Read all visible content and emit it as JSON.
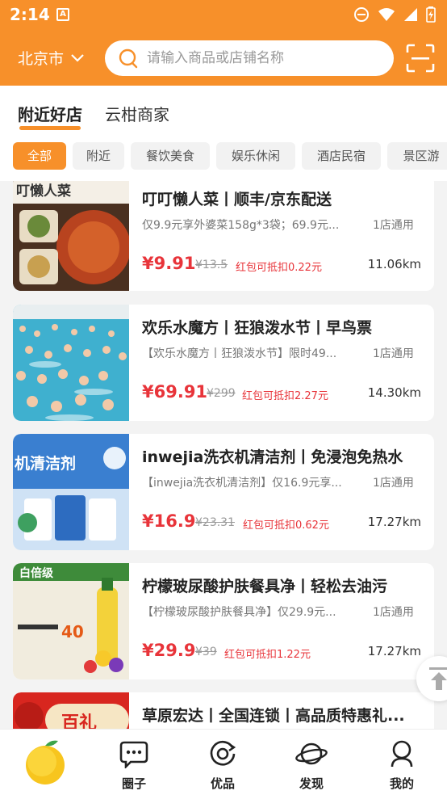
{
  "status_bar": {
    "time": "2:14",
    "icons": [
      "a-notification-icon",
      "dnd-icon",
      "wifi-icon",
      "signal-icon",
      "battery-icon"
    ]
  },
  "header": {
    "city": "北京市",
    "search_placeholder": "请输入商品或店铺名称",
    "accent_color": "#f7902a"
  },
  "tabs": [
    {
      "label": "附近好店",
      "active": true
    },
    {
      "label": "云柑商家",
      "active": false
    }
  ],
  "filters": [
    {
      "label": "全部",
      "active": true
    },
    {
      "label": "附近",
      "active": false
    },
    {
      "label": "餐饮美食",
      "active": false
    },
    {
      "label": "娱乐休闲",
      "active": false
    },
    {
      "label": "酒店民宿",
      "active": false
    },
    {
      "label": "景区游",
      "active": false
    }
  ],
  "items": [
    {
      "title": "叮叮懒人菜丨顺丰/京东配送",
      "desc": "仅9.9元享外婆菜158g*3袋；69.9元...",
      "scope": "1店通用",
      "price": "¥9.91",
      "original": "¥13.5",
      "redpack": "红包可抵扣0.22元",
      "distance": "11.06km",
      "thumb_text": "叮懒人菜"
    },
    {
      "title": "欢乐水魔方丨狂狼泼水节丨早鸟票",
      "desc": "【欢乐水魔方丨狂狼泼水节】限时49...",
      "scope": "1店通用",
      "price": "¥69.91",
      "original": "¥299",
      "redpack": "红包可抵扣2.27元",
      "distance": "14.30km",
      "thumb_text": ""
    },
    {
      "title": "inwejia洗衣机清洁剂丨免浸泡免热水",
      "desc": "【inwejia洗衣机清洁剂】仅16.9元享...",
      "scope": "1店通用",
      "price": "¥16.9",
      "original": "¥23.31",
      "redpack": "红包可抵扣0.62元",
      "distance": "17.27km",
      "thumb_text": "机清洁剂"
    },
    {
      "title": "柠檬玻尿酸护肤餐具净丨轻松去油污",
      "desc": "【柠檬玻尿酸护肤餐具净】仅29.9元...",
      "scope": "1店通用",
      "price": "¥29.9",
      "original": "¥39",
      "redpack": "红包可抵扣1.22元",
      "distance": "17.27km",
      "thumb_text": "白倍级"
    },
    {
      "title": "草原宏达丨全国连锁丨高品质特惠礼...",
      "desc": "",
      "scope": "",
      "price": "",
      "original": "",
      "redpack": "",
      "distance": "",
      "thumb_text": "百礼"
    }
  ],
  "nav": [
    {
      "label": "",
      "icon": "orange-fruit-icon"
    },
    {
      "label": "圈子",
      "icon": "chat-bubble-icon"
    },
    {
      "label": "优品",
      "icon": "refresh-circle-icon"
    },
    {
      "label": "发现",
      "icon": "planet-icon"
    },
    {
      "label": "我的",
      "icon": "person-icon"
    }
  ]
}
